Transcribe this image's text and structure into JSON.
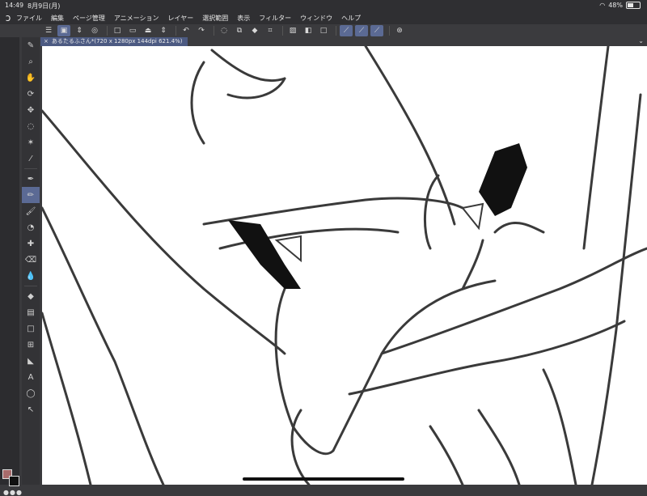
{
  "status": {
    "time": "14:49",
    "date": "8月9日(月)",
    "battery_pct": "48%",
    "battery_level": 0.48
  },
  "menubar": {
    "items": [
      "ファイル",
      "編集",
      "ページ管理",
      "アニメーション",
      "レイヤー",
      "選択範囲",
      "表示",
      "フィルター",
      "ウィンドウ",
      "ヘルプ"
    ]
  },
  "document": {
    "tab_label": "あるたるふさん*(720 x 1280px 144dpi 621.4%)"
  },
  "colors": {
    "main": "#a86b6b",
    "sub": "#111111",
    "accent": "#5b6a94"
  },
  "toolbar": {
    "icons": [
      "menu-icon",
      "layer-settings-icon",
      "sort-icon",
      "new-icon",
      "open-icon",
      "save-icon",
      "export-icon",
      "undo-icon",
      "redo-icon",
      "select-icon",
      "transform-icon",
      "fill-icon",
      "crop-icon",
      "stroke-a-icon",
      "stroke-b-icon",
      "stroke-c-icon",
      "ruler-icon"
    ]
  }
}
